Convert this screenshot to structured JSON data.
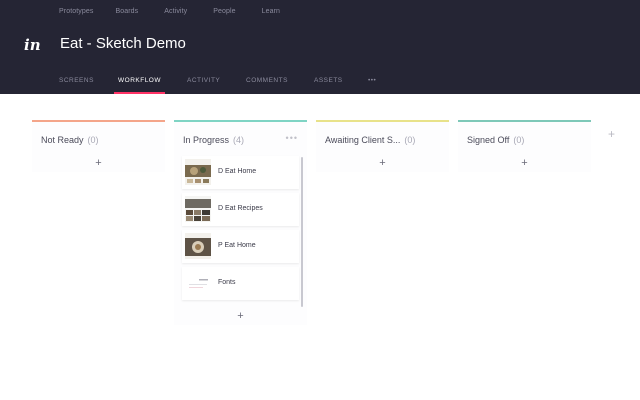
{
  "topnav": [
    "Prototypes",
    "Boards",
    "Activity",
    "People",
    "Learn"
  ],
  "brand": {
    "logo": "in"
  },
  "project": {
    "title": "Eat - Sketch Demo"
  },
  "tabs": [
    {
      "label": "SCREENS"
    },
    {
      "label": "WORKFLOW",
      "active": true
    },
    {
      "label": "ACTIVITY"
    },
    {
      "label": "COMMENTS"
    },
    {
      "label": "ASSETS"
    },
    {
      "label": "•••"
    }
  ],
  "columns": [
    {
      "title": "Not Ready",
      "count": "(0)",
      "color": "#f4a58a",
      "add": "+"
    },
    {
      "title": "In Progress",
      "count": "(4)",
      "color": "#7fd4c4",
      "add": "+",
      "more": "•••"
    },
    {
      "title": "Awaiting Client S...",
      "count": "(0)",
      "color": "#e8e28a",
      "add": "+"
    },
    {
      "title": "Signed Off",
      "count": "(0)",
      "color": "#7ec8b8",
      "add": "+"
    }
  ],
  "cards": [
    {
      "label": "D Eat Home",
      "thumb_icon": "food-photo-thumbnail"
    },
    {
      "label": "D Eat Recipes",
      "thumb_icon": "recipe-grid-thumbnail"
    },
    {
      "label": "P Eat Home",
      "thumb_icon": "food-photo-thumbnail"
    },
    {
      "label": "Fonts",
      "thumb_icon": "fonts-page-thumbnail"
    }
  ],
  "add_column": "+"
}
